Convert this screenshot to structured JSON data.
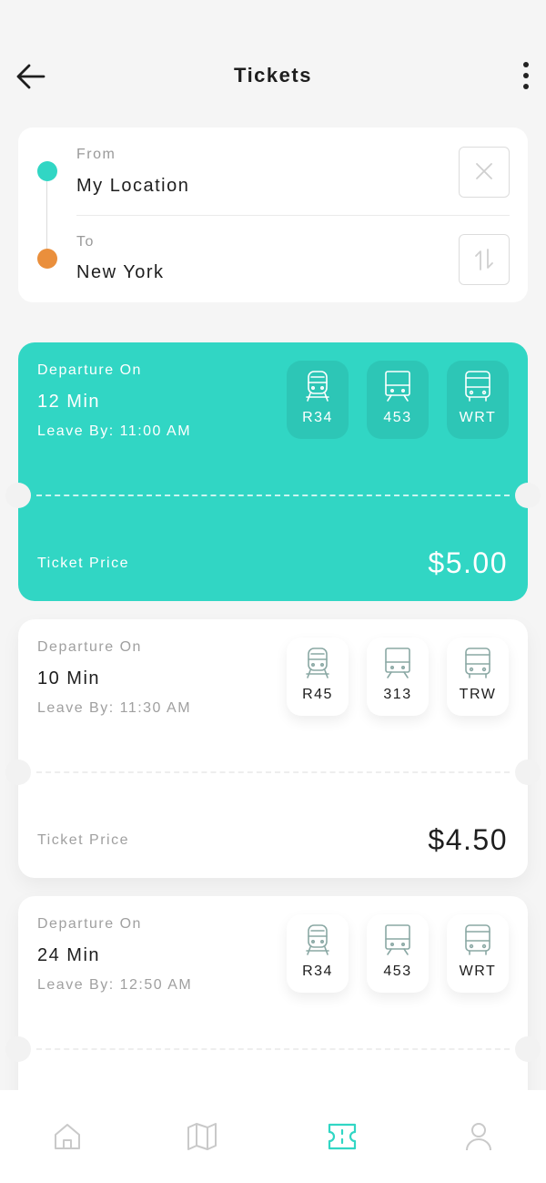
{
  "header": {
    "title": "Tickets",
    "back_icon": "arrow-left-icon",
    "menu_icon": "more-vertical-icon"
  },
  "route": {
    "from_label": "From",
    "from_value": "My Location",
    "to_label": "To",
    "to_value": "New York",
    "clear_icon": "close-icon",
    "swap_icon": "swap-icon",
    "from_color": "#31d6c4",
    "to_color": "#ea8f3c"
  },
  "tickets": [
    {
      "departure_label": "Departure On",
      "departure_time": "12 Min",
      "leave_by": "Leave By: 11:00 AM",
      "vehicles": [
        {
          "icon": "train-icon",
          "code": "R34"
        },
        {
          "icon": "tram-icon",
          "code": "453"
        },
        {
          "icon": "bus-icon",
          "code": "WRT"
        }
      ],
      "price_label": "Ticket Price",
      "price": "$5.00",
      "selected": true
    },
    {
      "departure_label": "Departure On",
      "departure_time": "10 Min",
      "leave_by": "Leave By: 11:30 AM",
      "vehicles": [
        {
          "icon": "train-icon",
          "code": "R45"
        },
        {
          "icon": "tram-icon",
          "code": "313"
        },
        {
          "icon": "bus-icon",
          "code": "TRW"
        }
      ],
      "price_label": "Ticket Price",
      "price": "$4.50",
      "selected": false
    },
    {
      "departure_label": "Departure On",
      "departure_time": "24 Min",
      "leave_by": "Leave By: 12:50 AM",
      "vehicles": [
        {
          "icon": "train-icon",
          "code": "R34"
        },
        {
          "icon": "tram-icon",
          "code": "453"
        },
        {
          "icon": "bus-icon",
          "code": "WRT"
        }
      ],
      "selected": false
    }
  ],
  "bottom_nav": [
    {
      "icon": "home-icon",
      "active": false
    },
    {
      "icon": "map-icon",
      "active": false
    },
    {
      "icon": "ticket-icon",
      "active": true
    },
    {
      "icon": "profile-icon",
      "active": false
    }
  ],
  "colors": {
    "accent": "#31d6c4",
    "orange": "#ea8f3c",
    "nav_inactive": "#c9c9c9",
    "vehicle_icon": "#8aa8a4"
  }
}
